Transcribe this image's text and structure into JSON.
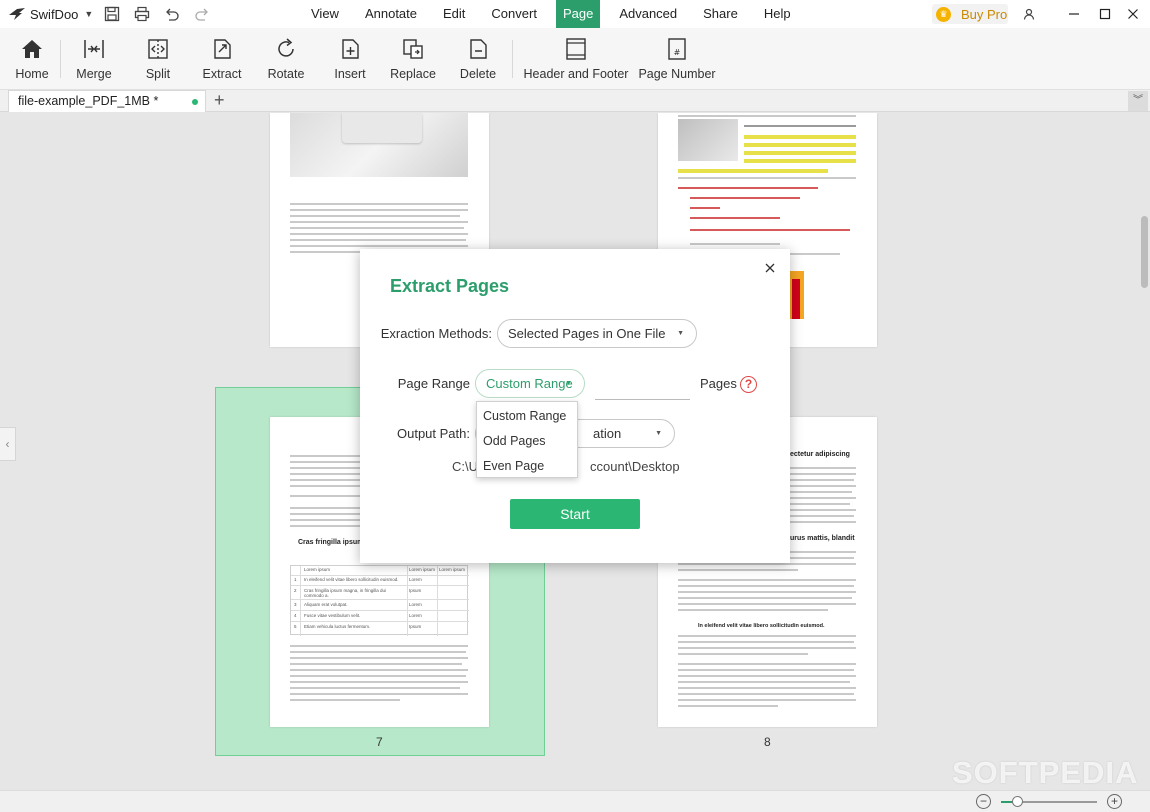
{
  "app": {
    "name": "SwifDoo"
  },
  "menus": [
    "View",
    "Annotate",
    "Edit",
    "Convert",
    "Page",
    "Advanced",
    "Share",
    "Help"
  ],
  "active_menu": "Page",
  "buy_pro": "Buy Pro",
  "toolbar": {
    "home": "Home",
    "merge": "Merge",
    "split": "Split",
    "extract": "Extract",
    "rotate": "Rotate",
    "insert": "Insert",
    "replace": "Replace",
    "delete": "Delete",
    "header_footer": "Header and Footer",
    "page_number": "Page Number"
  },
  "tab": {
    "label": "file-example_PDF_1MB *"
  },
  "pages": {
    "seven": "7",
    "eight": "8"
  },
  "page_text": {
    "p7_heading": "Cras fringilla ipsum a.",
    "p8_heading1": "ectetur adipiscing",
    "p8_heading2": "urus mattis, blandit",
    "p8_heading3": "In eleifend velit vitae libero sollicitudin euismod.",
    "p7_table": [
      [
        "",
        "Lorem ipsum",
        "Lorem ipsum",
        "Lorem ipsum"
      ],
      [
        "1",
        "In eleifend velit vitae libero sollicitudin euismod.",
        "Lorem",
        ""
      ],
      [
        "2",
        "Cras fringilla ipsum magna, in fringilla dui commodo a.",
        "Ipsum",
        ""
      ],
      [
        "3",
        "Aliquam erat volutpat.",
        "Lorem",
        ""
      ],
      [
        "4",
        "Fusce vitae vestibulum velit.",
        "Lorem",
        ""
      ],
      [
        "5",
        "Etiam vehicula luctus fermentum.",
        "Ipsum",
        ""
      ]
    ]
  },
  "dialog": {
    "title": "Extract Pages",
    "method_label": "Exraction Methods:",
    "method_value": "Selected Pages in One File",
    "range_label": "Page Range",
    "range_value": "Custom Range",
    "pages_label": "Pages",
    "help": "?",
    "output_label": "Output Path:",
    "output_value_tail": "ation",
    "path_head": "C:\\U",
    "path_tail": "ccount\\Desktop",
    "start": "Start"
  },
  "dropdown": {
    "options": [
      "Custom Range",
      "Odd Pages",
      "Even Page"
    ]
  },
  "zoom": {
    "level_fraction": 0.18
  },
  "watermark": "SOFTPEDIA",
  "colors": {
    "accent": "#2c9e6b",
    "start_button": "#2bb673",
    "selection": "#b6e8c9"
  }
}
